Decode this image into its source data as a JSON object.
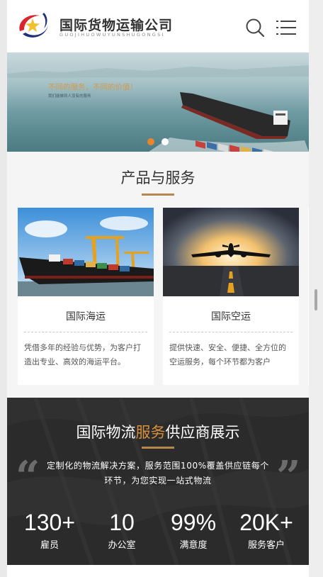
{
  "header": {
    "brand_name": "国际货物运输公司",
    "brand_sub": "GUOJIHUOWUYUNSHUGONGSI",
    "logo_icon": "company-logo-swoosh-star",
    "search_icon": "search-icon",
    "menu_icon": "menu-icon"
  },
  "banner": {
    "slogan": "不同的服务，不同的价值！",
    "subtext": "我们能做到人没有的服务",
    "active_slide": 1,
    "slide_count": 2
  },
  "products": {
    "title": "产品与服务",
    "cards": [
      {
        "title": "国际海运",
        "description": "凭借多年的经验与优势，为客户打造出专业、高效的海运平台。"
      },
      {
        "title": "国际空运",
        "description": "提供快速、安全、便捷、全方位的空运服务，每个环节都为客户"
      }
    ]
  },
  "stats": {
    "title_pre": "国际物流",
    "title_hl": "服务",
    "title_post": "供应商展示",
    "description": "定制化的物流解决方案，服务范围100%覆盖供应链每个环节，为您实现一站式物流",
    "items": [
      {
        "number": "130+",
        "label": "雇员"
      },
      {
        "number": "10",
        "label": "办公室"
      },
      {
        "number": "99%",
        "label": "满意度"
      },
      {
        "number": "20K+",
        "label": "服务客户"
      }
    ]
  },
  "colors": {
    "accent": "#b8874d",
    "highlight": "#d8903f",
    "active_dot": "#e8862c",
    "dark_section": "#2b2b2b",
    "logo_red": "#d9262c",
    "logo_navy": "#1f2f7a",
    "logo_yellow": "#f2c12e"
  }
}
